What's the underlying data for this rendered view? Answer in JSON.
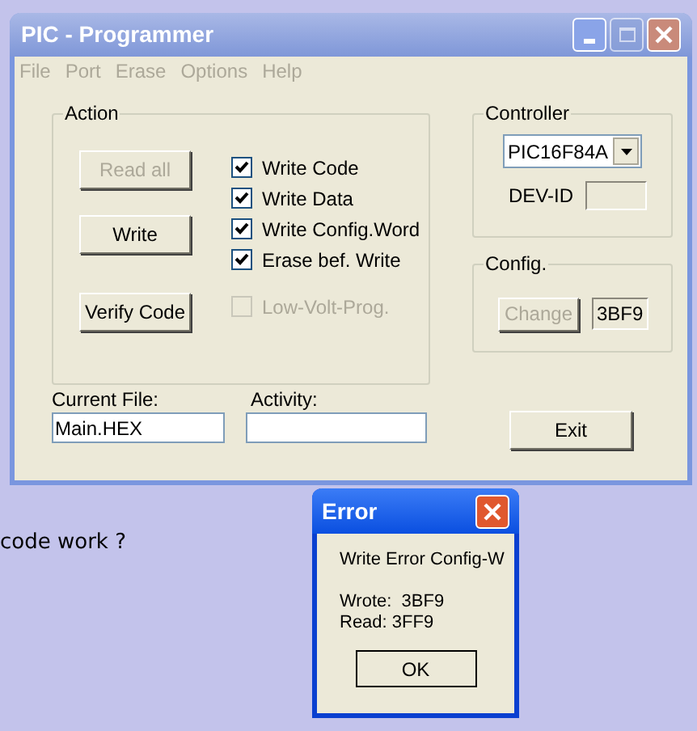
{
  "background_text": [
    {
      "text": "code work ?"
    }
  ],
  "window": {
    "title": "PIC - Programmer",
    "maximize_disabled": true
  },
  "menu": [
    {
      "label": "File"
    },
    {
      "label": "Port"
    },
    {
      "label": "Erase"
    },
    {
      "label": "Options"
    },
    {
      "label": "Help"
    }
  ],
  "action": {
    "title": "Action",
    "buttons": [
      {
        "label": "Read all",
        "disabled": true
      },
      {
        "label": "Write",
        "disabled": false
      },
      {
        "label": "Verify Code",
        "disabled": false
      }
    ],
    "checkboxes": [
      {
        "label": "Write Code",
        "checked": true,
        "disabled": false
      },
      {
        "label": "Write Data",
        "checked": true,
        "disabled": false
      },
      {
        "label": "Write Config.Word",
        "checked": true,
        "disabled": false
      },
      {
        "label": "Erase bef. Write",
        "checked": true,
        "disabled": false
      },
      {
        "label": "Low-Volt-Prog.",
        "checked": false,
        "disabled": true
      }
    ]
  },
  "controller": {
    "title": "Controller",
    "value": "PIC16F84A",
    "dev_id_label": "DEV-ID"
  },
  "config": {
    "title": "Config.",
    "button": {
      "label": "Change",
      "disabled": true
    },
    "value": "3BF9"
  },
  "current_file": {
    "label": "Current File:",
    "value": "Main.HEX"
  },
  "activity": {
    "label": "Activity:"
  },
  "exit_button": {
    "label": "Exit"
  },
  "dialog": {
    "title": "Error",
    "message": "Write Error Config-W",
    "lines": [
      "Wrote:  3BF9",
      "Read: 3FF9"
    ],
    "button": "OK"
  }
}
